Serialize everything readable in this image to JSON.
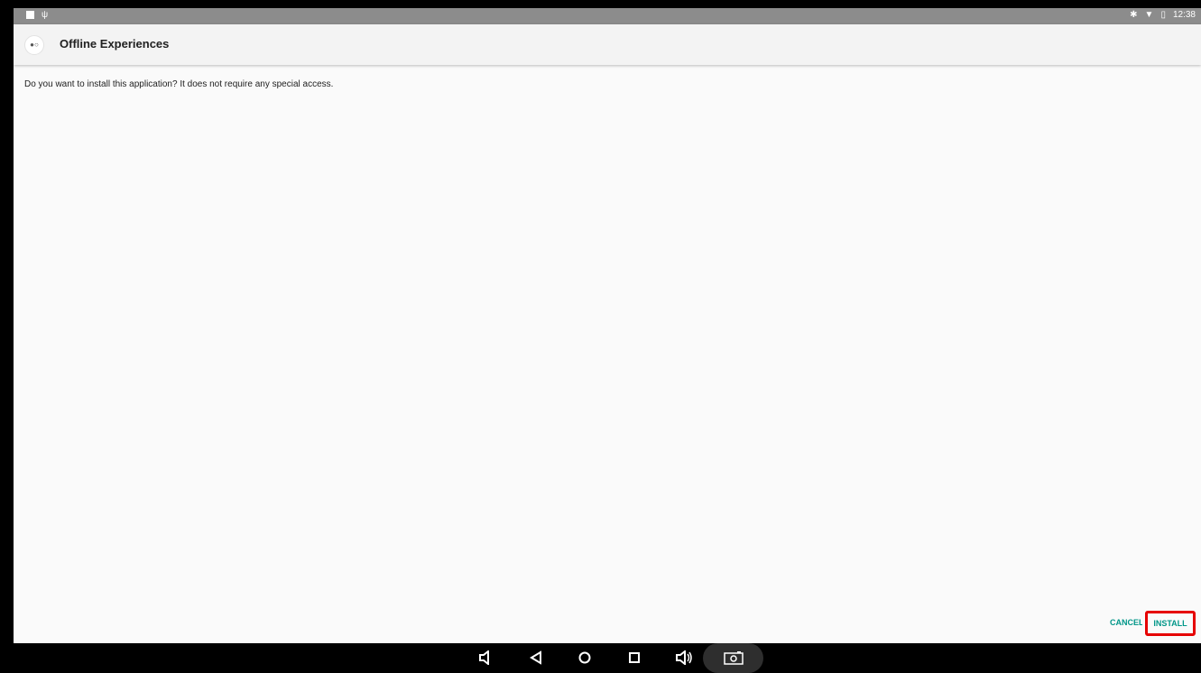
{
  "status_bar": {
    "time": "12:38",
    "left_icons": [
      "image-notification-icon",
      "usb-icon"
    ],
    "right_icons": [
      "bluetooth-icon",
      "wifi-icon",
      "battery-icon"
    ],
    "background": "#8c8c8c"
  },
  "app_bar": {
    "title": "Offline Experiences"
  },
  "dialog": {
    "message": "Do you want to install this application? It does not require any special access.",
    "cancel_label": "CANCEL",
    "install_label": "INSTALL",
    "button_color": "#009688",
    "highlight_color": "#e60000"
  },
  "nav_bar": {
    "icons": [
      "volume-down-icon",
      "back-icon",
      "home-icon",
      "recents-icon",
      "volume-up-icon",
      "screenshot-icon"
    ]
  }
}
